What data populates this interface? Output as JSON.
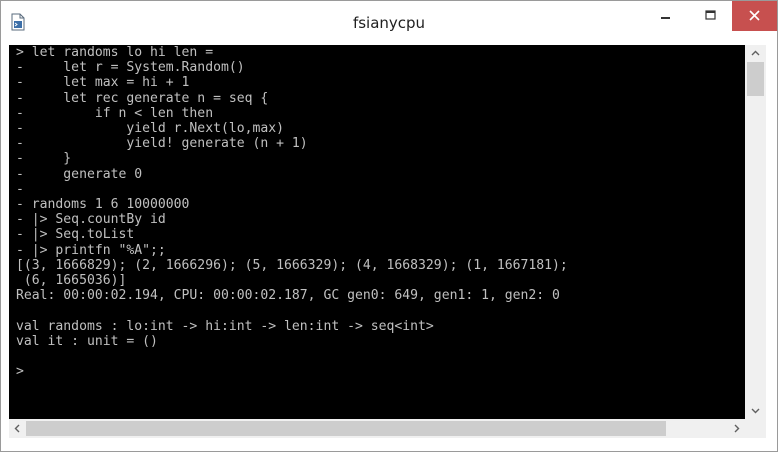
{
  "window": {
    "title": "fsianycpu",
    "colors": {
      "console_bg": "#000000",
      "console_fg": "#c0c0c0",
      "close_bg": "#c7504f"
    }
  },
  "console": {
    "lines": [
      "> let randoms lo hi len =",
      "-     let r = System.Random()",
      "-     let max = hi + 1",
      "-     let rec generate n = seq {",
      "-         if n < len then",
      "-             yield r.Next(lo,max)",
      "-             yield! generate (n + 1)",
      "-     }",
      "-     generate 0",
      "-",
      "- randoms 1 6 10000000",
      "- |> Seq.countBy id",
      "- |> Seq.toList",
      "- |> printfn \"%A\";;",
      "[(3, 1666829); (2, 1666296); (5, 1666329); (4, 1668329); (1, 1667181);",
      " (6, 1665036)]",
      "Real: 00:00:02.194, CPU: 00:00:02.187, GC gen0: 649, gen1: 1, gen2: 0",
      "",
      "val randoms : lo:int -> hi:int -> len:int -> seq<int>",
      "val it : unit = ()",
      "",
      ">"
    ]
  },
  "icons": {
    "app": "console-app-icon",
    "minimize": "minimize-icon",
    "maximize": "maximize-icon",
    "close": "close-icon",
    "scroll_up": "chevron-up-icon",
    "scroll_down": "chevron-down-icon",
    "scroll_left": "chevron-left-icon",
    "scroll_right": "chevron-right-icon"
  }
}
